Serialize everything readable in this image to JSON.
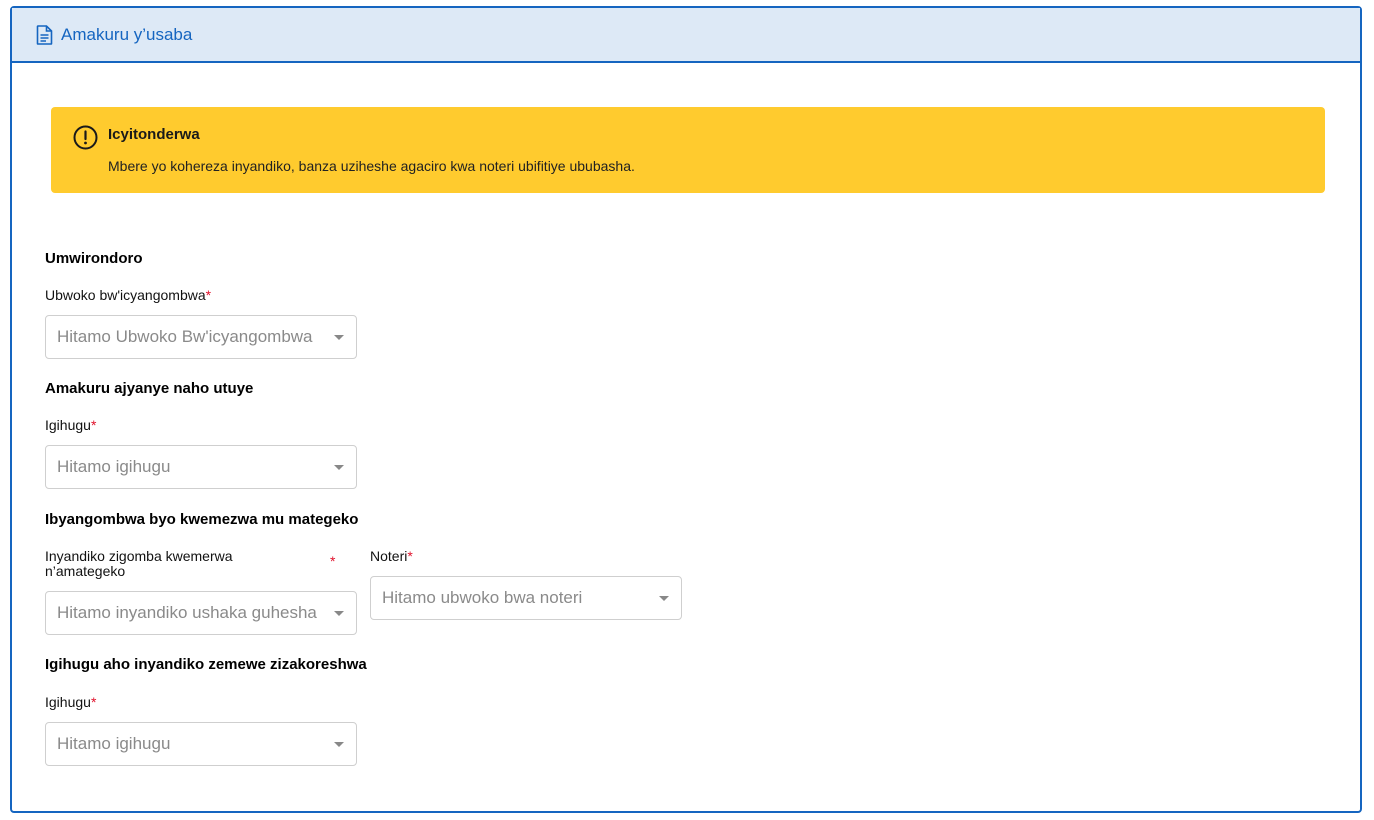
{
  "header": {
    "title": "Amakuru y’usaba",
    "icon": "document-icon"
  },
  "alert": {
    "icon": "exclamation-circle-icon",
    "title": "Icyitonderwa",
    "text": "Mbere yo kohereza inyandiko, banza uziheshe agaciro kwa noteri ubifitiye ububasha.",
    "color": "#ffcb2e"
  },
  "sections": {
    "profile": {
      "title": "Umwirondoro",
      "document_type_label": "Ubwoko bw'icyangombwa",
      "document_type_placeholder": "Hitamo Ubwoko Bw'icyangombwa"
    },
    "residence": {
      "title": "Amakuru ajyanye naho utuye",
      "country_label": "Igihugu",
      "country_placeholder": "Hitamo igihugu"
    },
    "legalization": {
      "title": "Ibyangombwa byo kwemezwa mu mategeko",
      "documents_label_line1": "Inyandiko zigomba kwemerwa",
      "documents_label_line2": "n’amategeko",
      "documents_placeholder": "Hitamo inyandiko ushaka guhesha",
      "notary_label": "Noteri",
      "notary_placeholder": "Hitamo ubwoko bwa noteri"
    },
    "usage_country": {
      "title": "Igihugu aho inyandiko zemewe zizakoreshwa",
      "country_label": "Igihugu",
      "country_placeholder": "Hitamo igihugu"
    }
  },
  "required_marker": "*",
  "colors": {
    "accent": "#1565c0",
    "header_bg": "#dde9f6",
    "required": "#e0102a"
  }
}
